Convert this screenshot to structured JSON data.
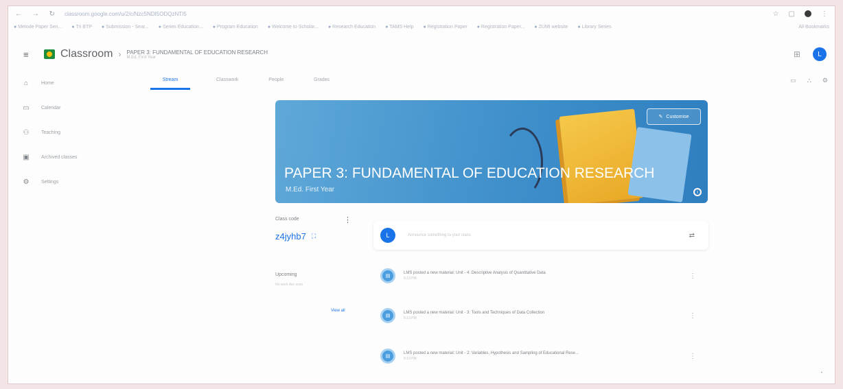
{
  "browser": {
    "url": "classroom.google.com/u/2/c/Nzc5NDI5ODQzNTI5",
    "bookmarks": [
      "Metode Paper Sen...",
      "Tri BTP",
      "Submission - Sear...",
      "Series Education...",
      "Program Education",
      "Welcome to Scholar...",
      "Research Education",
      "TAMS Help",
      "Registration Paper",
      "Registration Paper...",
      "ZUMI website",
      "Library Series"
    ],
    "bookmarks_right": "All Bookmarks"
  },
  "header": {
    "brand": "Classroom",
    "class_title": "PAPER 3: FUNDAMENTAL OF EDUCATION RESEARCH",
    "class_sub": "M.Ed. First Year",
    "avatar_letter": "L"
  },
  "sidebar": {
    "items": [
      {
        "label": "Home",
        "icon": "home-icon",
        "glyph": "⌂"
      },
      {
        "label": "Calendar",
        "icon": "calendar-icon",
        "glyph": "▭"
      },
      {
        "label": "Teaching",
        "icon": "people-icon",
        "glyph": "⚇"
      },
      {
        "label": "Archived classes",
        "icon": "archive-icon",
        "glyph": "▣"
      },
      {
        "label": "Settings",
        "icon": "gear-icon",
        "glyph": "⚙"
      }
    ]
  },
  "tabs": [
    "Stream",
    "Classwork",
    "People",
    "Grades"
  ],
  "banner": {
    "title": "PAPER 3: FUNDAMENTAL OF EDUCATION RESEARCH",
    "subtitle": "M.Ed. First Year",
    "customise_label": "Customise",
    "color": "#3f8fcb"
  },
  "class_code": {
    "label": "Class code",
    "value": "z4jyhb7"
  },
  "upcoming": {
    "title": "Upcoming",
    "empty": "No work due soon",
    "view_all": "View all"
  },
  "announce": {
    "avatar_letter": "L",
    "placeholder": "Announce something to your class"
  },
  "posts": [
    {
      "title": "LMS posted a new material: Unit - 4: Descriptive Analysis of Quantitative Data",
      "date": "6:13 PM"
    },
    {
      "title": "LMS posted a new material: Unit - 3: Tools and Techniques of Data Collection",
      "date": "6:13 PM"
    },
    {
      "title": "LMS posted a new material: Unit - 2: Variables, Hypothesis and Sampling of Educational Rese...",
      "date": "6:13 PM"
    }
  ],
  "accent_color": "#1a73e8"
}
